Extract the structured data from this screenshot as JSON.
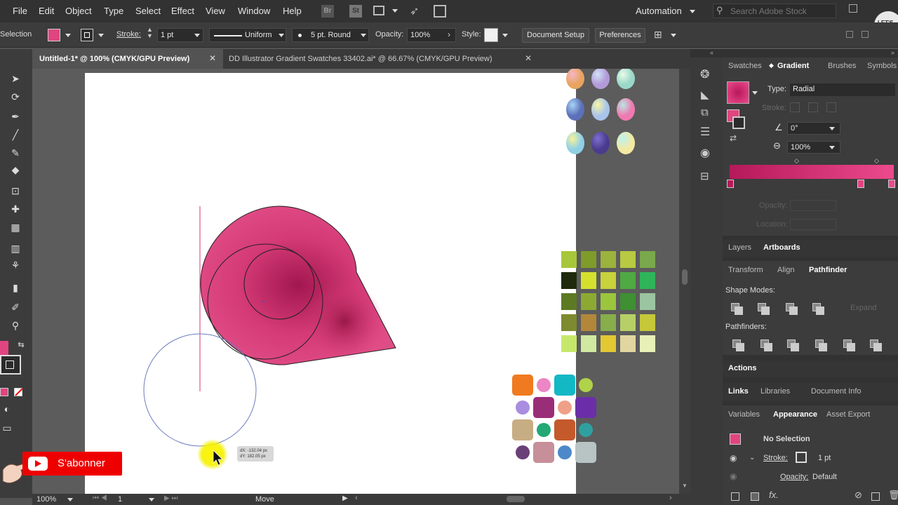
{
  "menu": {
    "items": [
      "File",
      "Edit",
      "Object",
      "Type",
      "Select",
      "Effect",
      "View",
      "Window",
      "Help"
    ],
    "br_label": "Br",
    "st_label": "St",
    "workspace": "Automation",
    "search_placeholder": "Search Adobe Stock"
  },
  "control": {
    "selection_label": "Selection",
    "stroke_label": "Stroke:",
    "stroke_value": "1 pt",
    "profile_value": "Uniform",
    "brush_value": "5 pt. Round",
    "opacity_label": "Opacity:",
    "opacity_value": "100%",
    "style_label": "Style:",
    "document_setup": "Document Setup",
    "preferences": "Preferences"
  },
  "tabs": [
    {
      "label": "Untitled-1* @ 100% (CMYK/GPU Preview)",
      "active": true
    },
    {
      "label": "DD Illustrator Gradient Swatches 33402.ai* @ 66.67% (CMYK/GPU Preview)",
      "active": false
    }
  ],
  "canvas": {
    "readout_dx": "dX: -132.04 px",
    "readout_dy": "dY: 182.05 px"
  },
  "subscribe": {
    "label": "S'abonner"
  },
  "status": {
    "zoom": "100%",
    "artboard": "1",
    "tool": "Move"
  },
  "gradient_panel": {
    "tabs": [
      "Swatches",
      "Gradient",
      "Brushes",
      "Symbols"
    ],
    "type_label": "Type:",
    "type_value": "Radial",
    "stroke_label": "Stroke:",
    "angle_value": "0°",
    "aspect_value": "100%",
    "opacity_label": "Opacity:",
    "location_label": "Location:",
    "ramp_start": "#b5195a",
    "ramp_end": "#ec4a8c"
  },
  "layers_panel": {
    "tabs": [
      "Layers",
      "Artboards"
    ]
  },
  "pathfinder_panel": {
    "tabs": [
      "Transform",
      "Align",
      "Pathfinder"
    ],
    "shape_modes": "Shape Modes:",
    "expand": "Expand",
    "pathfinders": "Pathfinders:"
  },
  "actions_panel": {
    "label": "Actions"
  },
  "links_panel": {
    "tabs": [
      "Links",
      "Libraries",
      "Document Info"
    ]
  },
  "appearance_panel": {
    "tabs": [
      "Variables",
      "Appearance",
      "Asset Export"
    ],
    "selection": "No Selection",
    "stroke_label": "Stroke:",
    "stroke_value": "1 pt",
    "opacity_label": "Opacity:",
    "opacity_value": "Default"
  },
  "colors": {
    "accent_pink": "#e0457f",
    "highlight_yellow": "#f5f000"
  },
  "logo_text": "LET'S BREAK"
}
